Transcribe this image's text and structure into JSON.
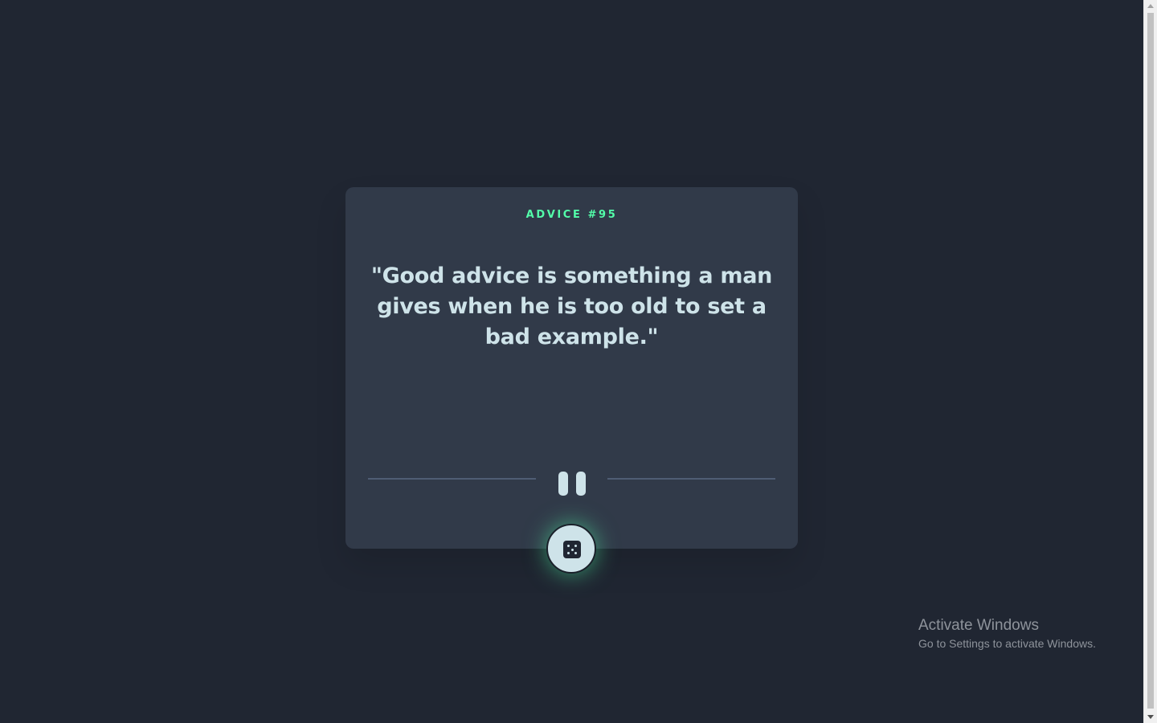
{
  "card": {
    "advice_label": "ADVICE #95",
    "quote": "\"Good advice is something a man gives when he is too old to set a bad example.\""
  },
  "icons": {
    "divider": "pause-icon",
    "generate": "dice-icon"
  },
  "colors": {
    "background": "#202632",
    "card": "#313a49",
    "accent_green": "#53ffaa",
    "text_light": "#cee3e9",
    "divider": "#4f5d74"
  },
  "watermark": {
    "title": "Activate Windows",
    "subtitle": "Go to Settings to activate Windows."
  }
}
